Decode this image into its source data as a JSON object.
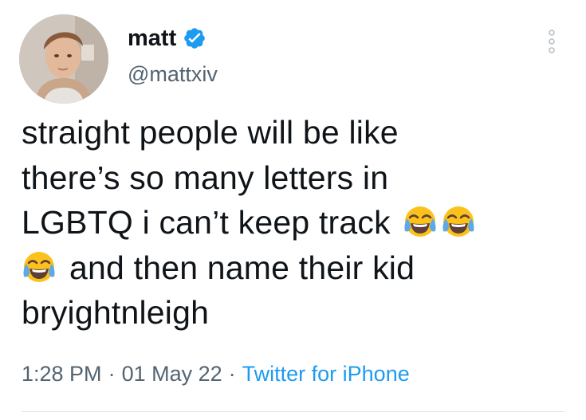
{
  "user": {
    "display_name": "matt",
    "handle": "@mattxiv",
    "verified": true
  },
  "tweet": {
    "lines": [
      "straight people will be like",
      "there’s so many letters in",
      "LGBTQ i can’t keep track",
      "and then name their kid",
      "bryightnleigh"
    ],
    "emoji": "face-with-tears-of-joy-icon"
  },
  "meta": {
    "time": "1:28 PM",
    "separator": "·",
    "date": "01 May 22",
    "source": "Twitter for iPhone"
  },
  "colors": {
    "text": "#0f1419",
    "secondary": "#536471",
    "link": "#1d9bf0",
    "verified": "#1d9bf0"
  }
}
